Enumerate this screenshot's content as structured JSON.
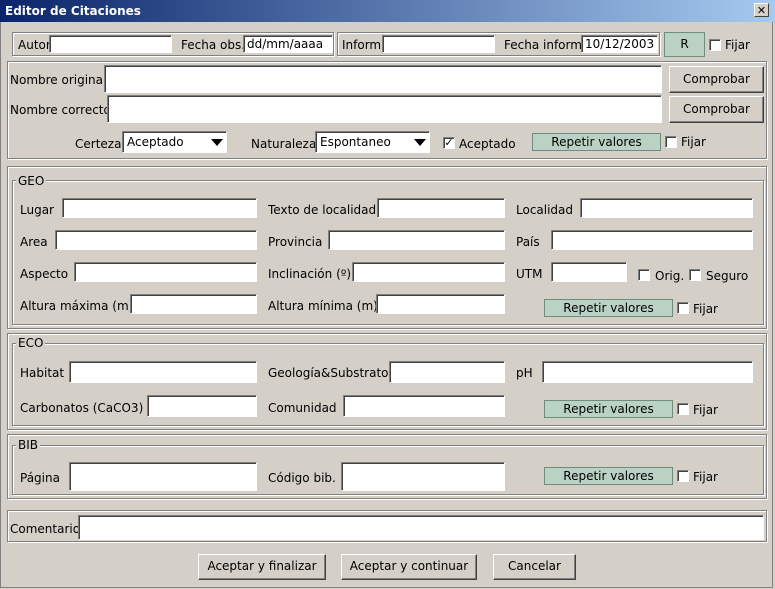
{
  "window": {
    "title": "Editor de Citaciones"
  },
  "top": {
    "autor_label": "Autor",
    "autor_value": "",
    "fecha_obs_label": "Fecha obs.",
    "fecha_obs_value": "dd/mm/aaaa",
    "inform_label": "Inform.",
    "inform_value": "",
    "fecha_inform_label": "Fecha inform.",
    "fecha_inform_value": "10/12/2003",
    "r_button": "R",
    "fijar": "Fijar"
  },
  "names": {
    "original_label": "Nombre original",
    "original_value": "",
    "correcto_label": "Nombre correcto",
    "correcto_value": "",
    "comprobar": "Comprobar",
    "certeza_label": "Certeza",
    "certeza_value": "Aceptado",
    "naturaleza_label": "Naturaleza",
    "naturaleza_value": "Espontaneo",
    "aceptado_label": "Aceptado",
    "repetir": "Repetir valores",
    "fijar": "Fijar"
  },
  "geo": {
    "legend": "GEO",
    "lugar": "Lugar",
    "texto_localidad": "Texto de localidad",
    "localidad": "Localidad",
    "area": "Area",
    "provincia": "Provincia",
    "pais": "País",
    "aspecto": "Aspecto",
    "inclinacion": "Inclinación (º)",
    "utm": "UTM",
    "orig": "Orig.",
    "seguro": "Seguro",
    "altura_max": "Altura máxima (m)",
    "altura_min": "Altura mínima (m)",
    "repetir": "Repetir valores",
    "fijar": "Fijar"
  },
  "eco": {
    "legend": "ECO",
    "habitat": "Habitat",
    "geologia": "Geología&Substrato",
    "ph": "pH",
    "carbonatos": "Carbonatos (CaCO3)",
    "comunidad": "Comunidad",
    "repetir": "Repetir valores",
    "fijar": "Fijar"
  },
  "bib": {
    "legend": "BIB",
    "pagina": "Página",
    "codigo": "Código bib.",
    "repetir": "Repetir valores",
    "fijar": "Fijar"
  },
  "comentario": {
    "label": "Comentario",
    "value": ""
  },
  "footer": {
    "aceptar_finalizar": "Aceptar y finalizar",
    "aceptar_continuar": "Aceptar y continuar",
    "cancelar": "Cancelar"
  },
  "colors": {
    "titlebar": "#0a246a",
    "window_bg": "#d4d0c8",
    "repeat_button": "#b9d2c4"
  }
}
